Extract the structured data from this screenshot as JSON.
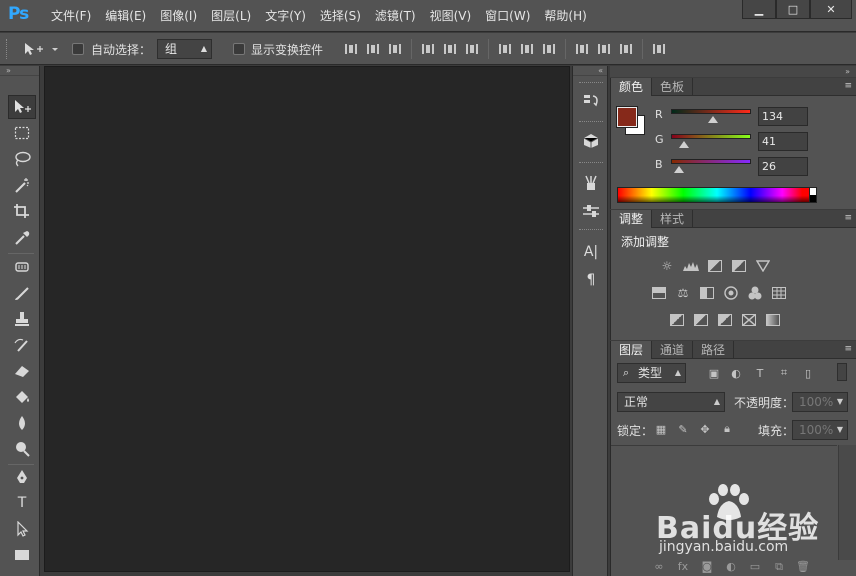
{
  "app": {
    "logo": "Ps"
  },
  "menu": [
    "文件(F)",
    "编辑(E)",
    "图像(I)",
    "图层(L)",
    "文字(Y)",
    "选择(S)",
    "滤镜(T)",
    "视图(V)",
    "窗口(W)",
    "帮助(H)"
  ],
  "window_controls": {
    "minimize": "▁",
    "maximize": "□",
    "close": "✕"
  },
  "options_bar": {
    "auto_select_label": "自动选择：",
    "auto_select_value": "组",
    "show_transform_label": "显示变换控件"
  },
  "tools": [
    "move-tool",
    "marquee-tool",
    "lasso-tool",
    "magic-wand-tool",
    "crop-tool",
    "eyedropper-tool",
    "healing-brush-tool",
    "brush-tool",
    "clone-stamp-tool",
    "history-brush-tool",
    "eraser-tool",
    "paint-bucket-tool",
    "blur-tool",
    "dodge-tool",
    "pen-tool",
    "type-tool",
    "path-selection-tool",
    "rectangle-tool"
  ],
  "type_tool_glyph": "T",
  "color_panel": {
    "tabs": [
      "颜色",
      "色板"
    ],
    "foreground_color": "#86291a",
    "channels": [
      {
        "label": "R",
        "value": "134",
        "fraction": 0.525
      },
      {
        "label": "G",
        "value": "41",
        "fraction": 0.16
      },
      {
        "label": "B",
        "value": "26",
        "fraction": 0.1
      }
    ]
  },
  "adjustments_panel": {
    "tabs": [
      "调整",
      "样式"
    ],
    "title": "添加调整"
  },
  "layers_panel": {
    "tabs": [
      "图层",
      "通道",
      "路径"
    ],
    "filter_value": "类型",
    "blend_mode": "正常",
    "opacity_label": "不透明度：",
    "opacity_value": "100%",
    "lock_label": "锁定：",
    "fill_label": "填充：",
    "fill_value": "100%"
  },
  "strip_icons": {
    "character": "A|",
    "paragraph": "¶"
  },
  "watermark": {
    "brand": "Baidu经验",
    "url": "jingyan.baidu.com"
  }
}
